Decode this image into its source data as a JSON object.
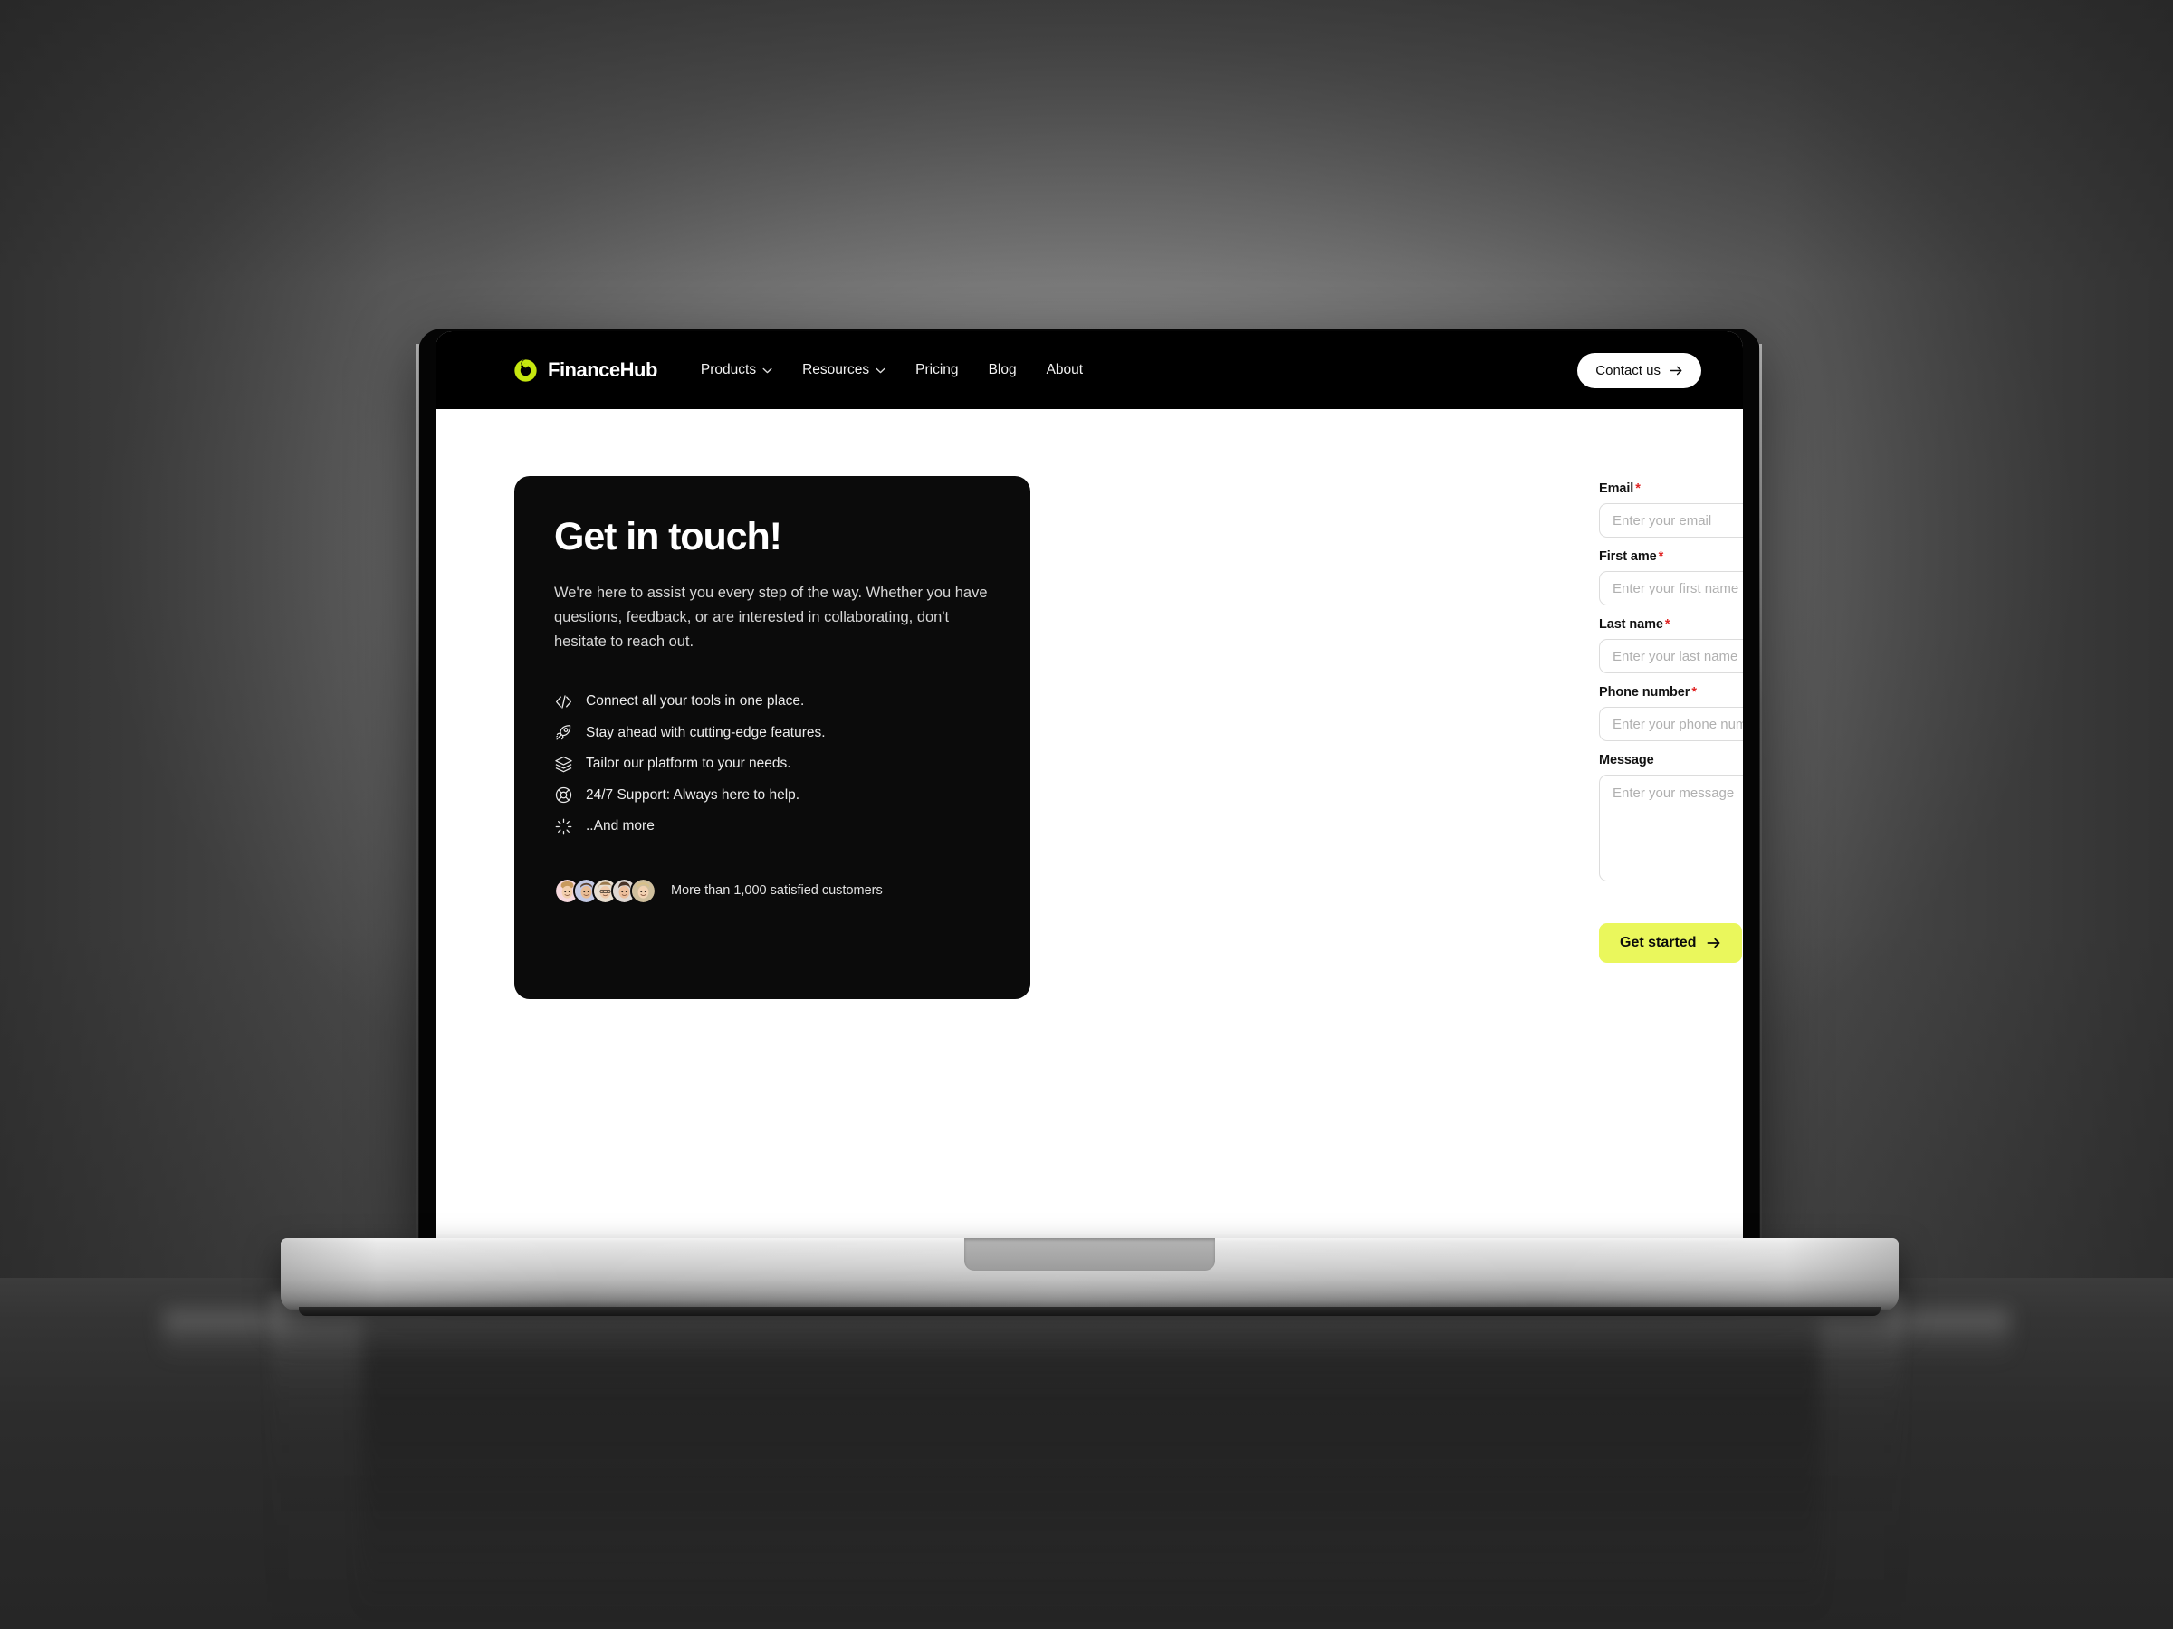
{
  "brand": {
    "name": "FinanceHub",
    "logo_icon": "financehub-circle-logo",
    "logo_color": "#c6e70f"
  },
  "nav": {
    "links": [
      {
        "label": "Products",
        "has_dropdown": true,
        "icon": "chevron-down-icon"
      },
      {
        "label": "Resources",
        "has_dropdown": true,
        "icon": "chevron-down-icon"
      },
      {
        "label": "Pricing",
        "has_dropdown": false
      },
      {
        "label": "Blog",
        "has_dropdown": false
      },
      {
        "label": "About",
        "has_dropdown": false
      }
    ],
    "cta": {
      "label": "Contact us",
      "icon": "arrow-right-icon"
    }
  },
  "info_card": {
    "title": "Get in touch!",
    "subtitle": "We're here to assist you every step of the way. Whether you have questions, feedback, or are interested in collaborating, don't hesitate to reach out.",
    "features": [
      {
        "icon": "code-brackets-icon",
        "text": "Connect all your tools in one place."
      },
      {
        "icon": "rocket-icon",
        "text": "Stay ahead with cutting-edge features."
      },
      {
        "icon": "layers-icon",
        "text": "Tailor our platform to your needs."
      },
      {
        "icon": "life-buoy-icon",
        "text": "24/7 Support: Always here to help."
      },
      {
        "icon": "sparkle-icon",
        "text": "..And more"
      }
    ],
    "social_proof": {
      "text": "More than 1,000 satisfied customers",
      "avatar_count": 5,
      "avatar_colors": [
        "#f6d8dc",
        "#c3c9e3",
        "#e8ded0",
        "#ded7d2",
        "#cfbf9d"
      ]
    }
  },
  "form": {
    "fields": [
      {
        "label": "Email",
        "required": true,
        "placeholder": "Enter your email",
        "value": "",
        "type": "input"
      },
      {
        "label": "First ame",
        "required": true,
        "placeholder": "Enter your first name",
        "value": "",
        "type": "input"
      },
      {
        "label": "Last name",
        "required": true,
        "placeholder": "Enter your last name",
        "value": "",
        "type": "input"
      },
      {
        "label": "Phone number",
        "required": true,
        "placeholder": "Enter your phone number",
        "value": "",
        "type": "input"
      },
      {
        "label": "Message",
        "required": false,
        "placeholder": "Enter your message",
        "value": "",
        "type": "textarea"
      }
    ],
    "required_marker": "*",
    "submit": {
      "label": "Get started",
      "icon": "arrow-right-icon",
      "color": "#eaf75c"
    }
  },
  "device": {
    "type": "laptop-mockup",
    "screen_background": "#ffffff",
    "navbar_background": "#000000"
  }
}
